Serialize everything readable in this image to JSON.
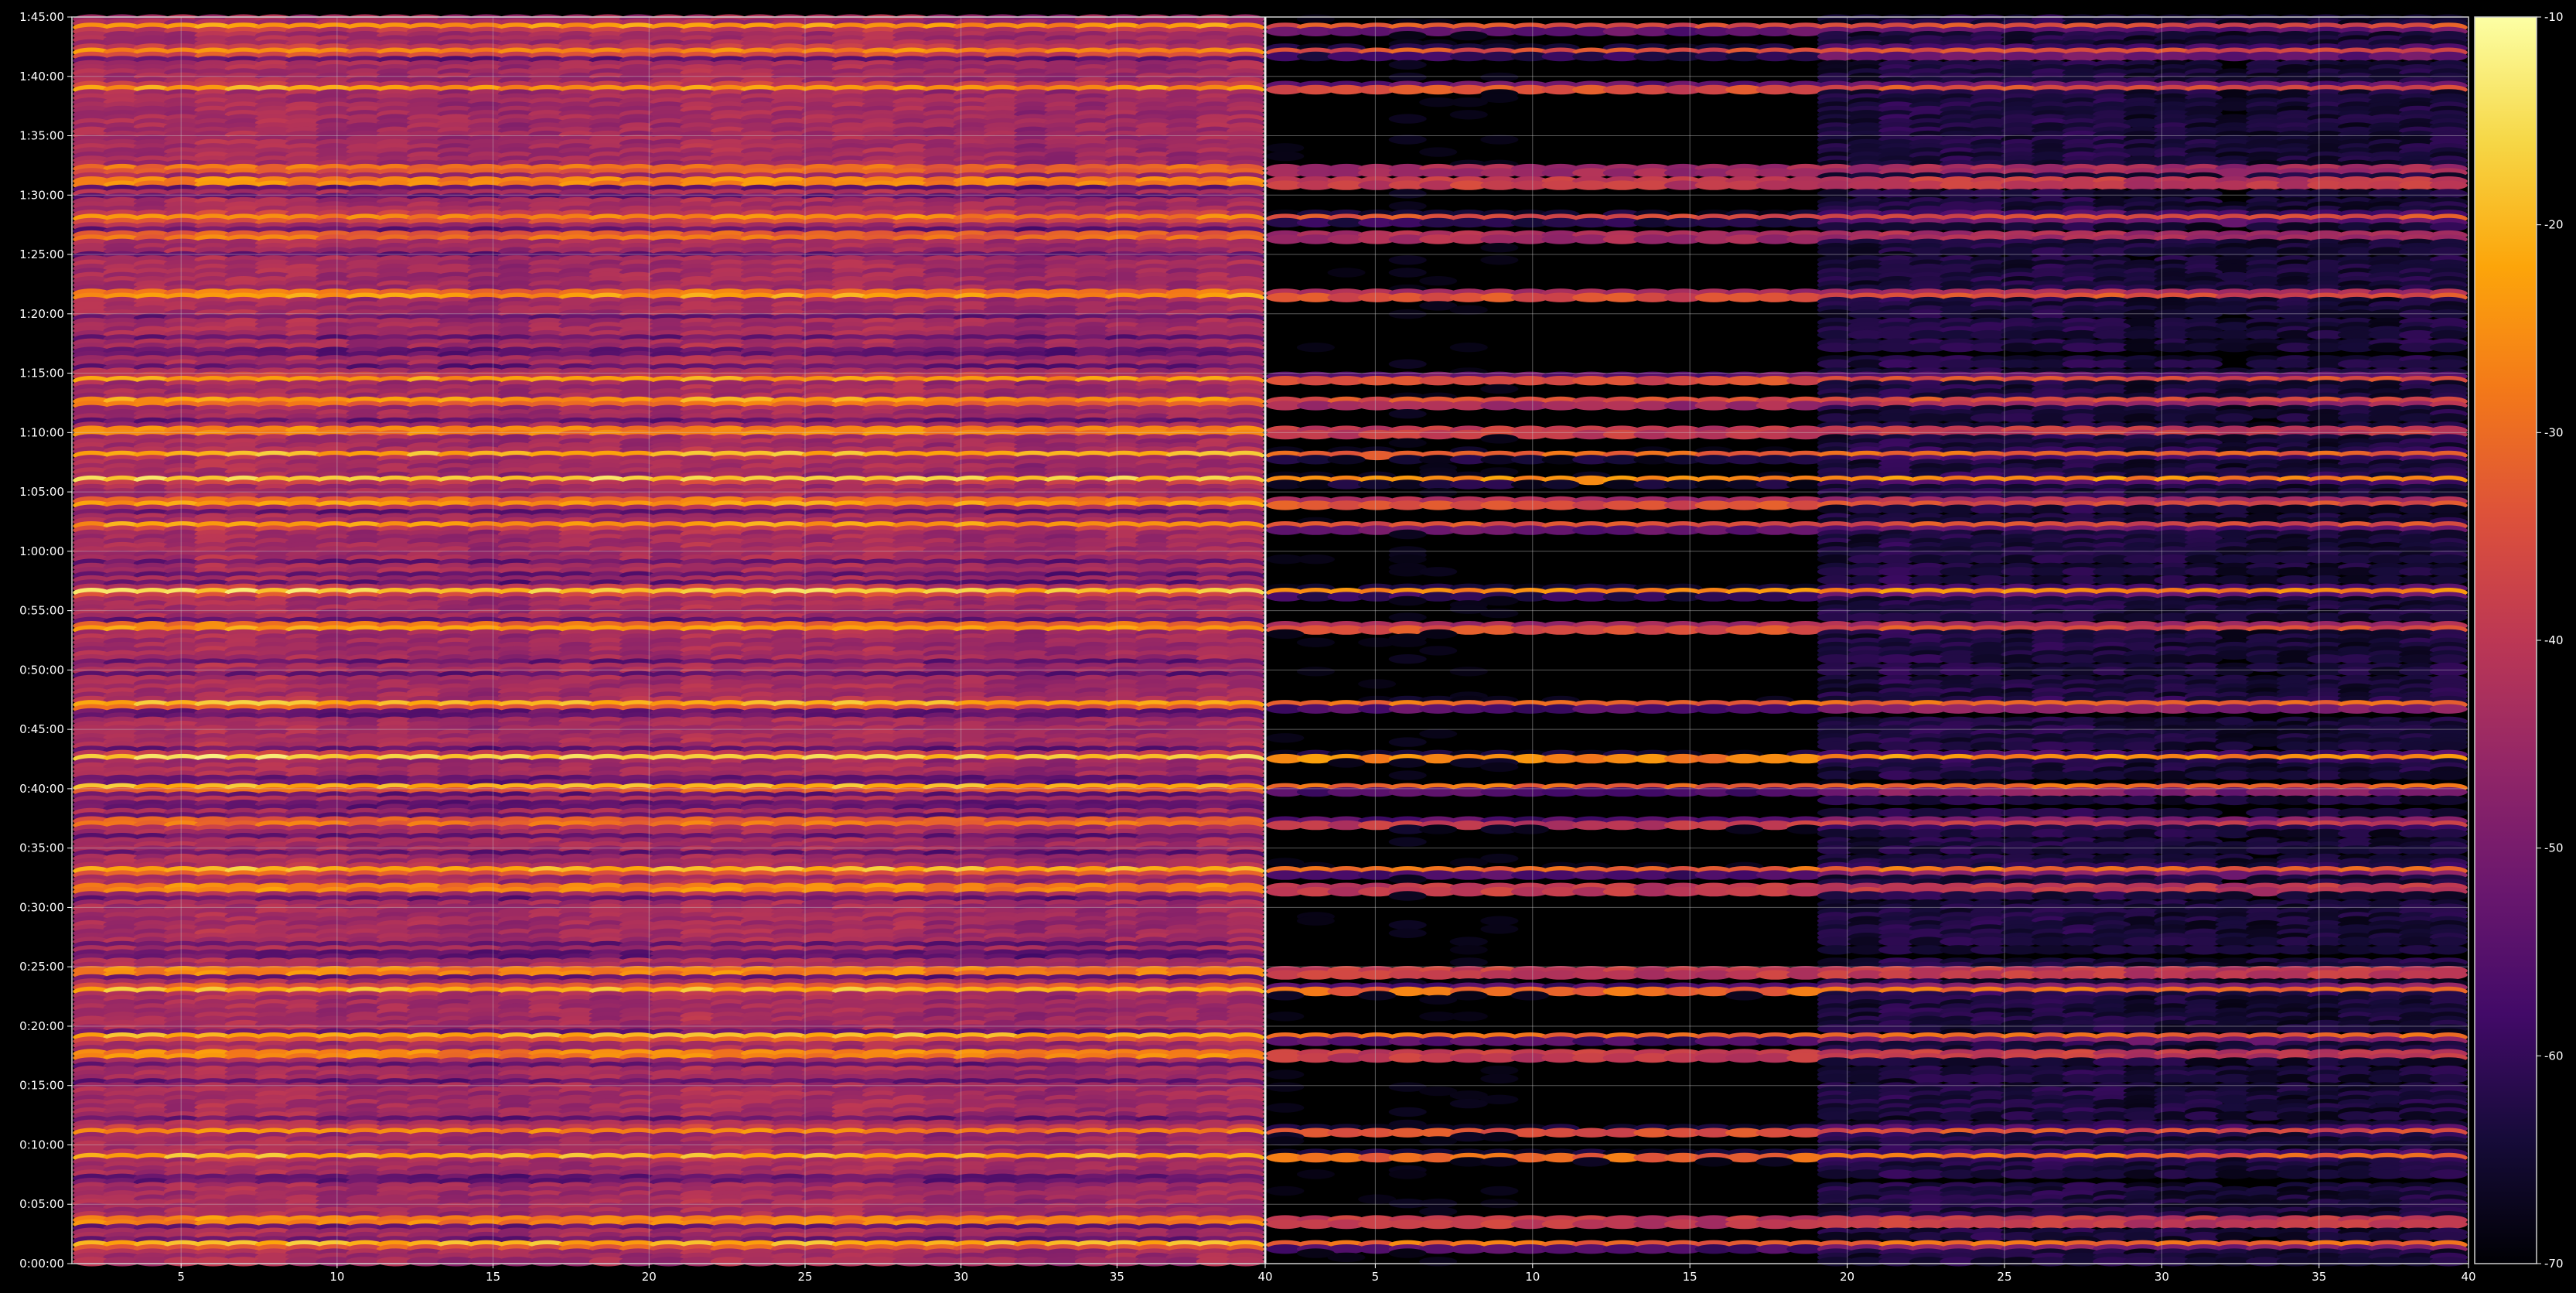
{
  "chart_data": {
    "type": "heatmap",
    "title": "",
    "colormap": "inferno",
    "background": "#000000",
    "grid": true,
    "panels": [
      {
        "name": "",
        "x_range": [
          1.5,
          39.75
        ],
        "x_ticks": [
          "5",
          "10",
          "15",
          "20",
          "25",
          "30",
          "35"
        ]
      },
      {
        "name": "",
        "x_range": [
          1.5,
          39.75
        ],
        "x_ticks": [
          "5",
          "10",
          "15",
          "20",
          "25",
          "30",
          "35"
        ]
      }
    ],
    "shared_x_tick_at_boundary": "40",
    "right_panel_edge_tick": "40",
    "y_ticks": [
      "0:00:00",
      "0:05:00",
      "0:10:00",
      "0:15:00",
      "0:20:00",
      "0:25:00",
      "0:30:00",
      "0:35:00",
      "0:40:00",
      "0:45:00",
      "0:50:00",
      "0:55:00",
      "1:00:00",
      "1:05:00",
      "1:10:00",
      "1:15:00",
      "1:20:00",
      "1:25:00",
      "1:30:00",
      "1:35:00",
      "1:40:00",
      "1:45:00"
    ],
    "y_range_minutes": [
      0,
      105
    ],
    "colorbar": {
      "range": [
        -70,
        -10
      ],
      "ticks": [
        "-10",
        "-20",
        "-30",
        "-40",
        "-50",
        "-60",
        "-70"
      ]
    },
    "strong_bands_minutes": [
      1,
      3,
      6,
      13,
      14,
      17,
      18.5,
      23.5,
      30.5,
      32.5,
      35,
      37,
      39,
      41,
      43,
      48.5,
      51.5,
      58,
      62.5,
      65,
      68,
      72,
      73.5,
      80.5,
      82,
      86,
      87.5,
      94,
      96,
      101.5,
      103.5
    ],
    "left_panel_level_range_dB": [
      -58,
      -12
    ],
    "right_panel_level_range_dB": [
      -70,
      -18
    ]
  }
}
